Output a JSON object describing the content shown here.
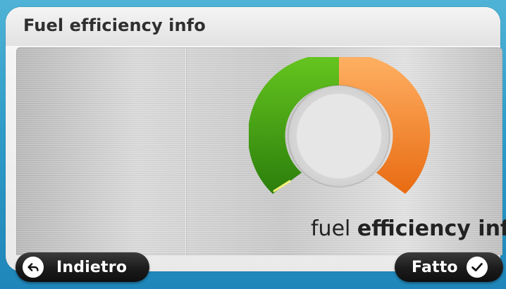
{
  "header": {
    "title": "Fuel efficiency info"
  },
  "main": {
    "caption_light": "fuel",
    "caption_bold": "efficiency info",
    "gauge": {
      "colors": {
        "green": "#2f8f0f",
        "orange": "#f07a14",
        "ring": "#d9d9d9"
      }
    }
  },
  "bottom": {
    "back_label": "Indietro",
    "done_label": "Fatto",
    "back_icon": "back-arrow-icon",
    "done_icon": "checkmark-icon"
  },
  "colors": {
    "background_blue": "#2f9cc8",
    "panel": "#efefef",
    "text_dark": "#222222",
    "button_dark": "#1b1b1b"
  }
}
